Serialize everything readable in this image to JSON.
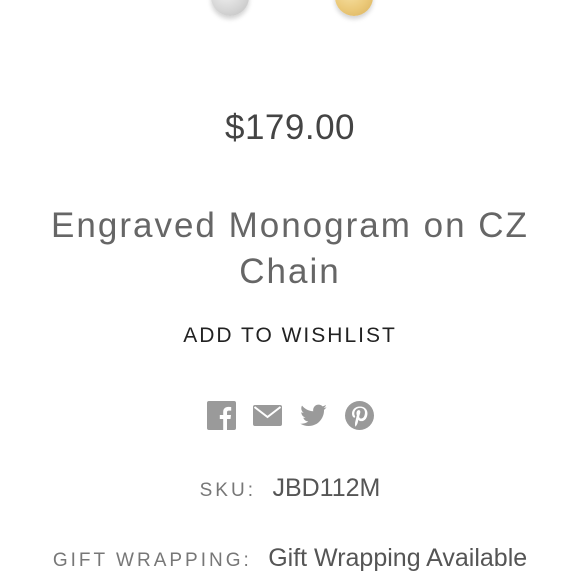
{
  "product": {
    "swatches": [
      {
        "name": "silver",
        "color": "#d9d9d9"
      },
      {
        "name": "gold",
        "color": "#ebc979"
      }
    ],
    "price": "$179.00",
    "title": "Engraved Monogram on CZ Chain",
    "wishlist_label": "ADD TO WISHLIST"
  },
  "share": {
    "icons": [
      "facebook-icon",
      "email-icon",
      "twitter-icon",
      "pinterest-icon"
    ],
    "icon_color": "#9a9a9a"
  },
  "details": {
    "sku_label": "SKU:",
    "sku_value": "JBD112M",
    "gift_label": "GIFT WRAPPING:",
    "gift_value": "Gift Wrapping Available"
  }
}
